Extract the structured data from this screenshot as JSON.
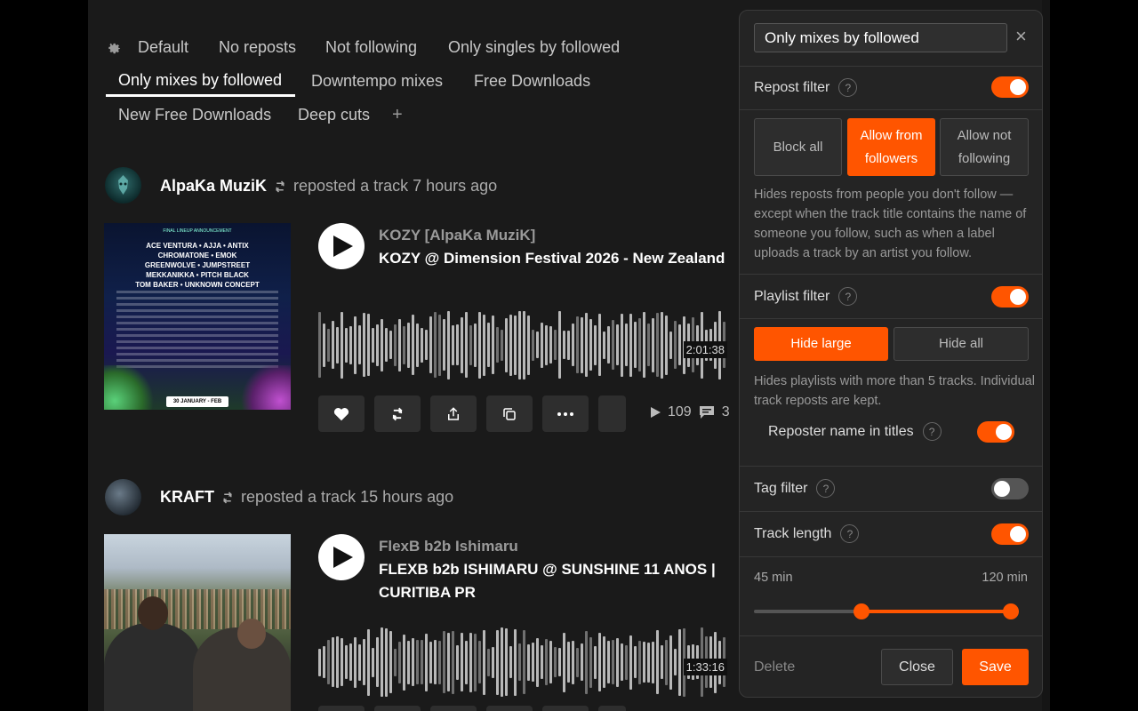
{
  "tabs": {
    "row1": [
      "Default",
      "No reposts",
      "Not following",
      "Only singles by followed"
    ],
    "row2": [
      "Only mixes by followed",
      "Downtempo mixes",
      "Free Downloads"
    ],
    "row3": [
      "New Free Downloads",
      "Deep cuts"
    ],
    "active": "Only mixes by followed",
    "add": "+"
  },
  "feed": [
    {
      "reposter": "AlpaKa MuziK",
      "action": "reposted a track 7 hours ago",
      "artist": "KOZY [AlpaKa MuziK]",
      "title": "KOZY @ Dimension Festival 2026 - New Zealand",
      "duration": "2:01:38",
      "plays": "109",
      "comments": "3",
      "poster": {
        "header": "FINAL LINEUP ANNOUNCEMENT",
        "lines": [
          "ACE VENTURA • AJJA • ANTIX",
          "CHROMATONE • EMOK",
          "GREENWOLVE • JUMPSTREET",
          "MEKKANIKKA • PITCH BLACK",
          "TOM BAKER • UNKNOWN CONCEPT"
        ],
        "date": "30 JANUARY - FEB"
      }
    },
    {
      "reposter": "KRAFT",
      "action": "reposted a track 15 hours ago",
      "artist": "FlexB b2b Ishimaru",
      "title": "FLEXB b2b ISHIMARU @ SUNSHINE 11 ANOS | CURITIBA PR",
      "duration": "1:33:16"
    }
  ],
  "panel": {
    "name": "Only mixes by followed",
    "close": "×",
    "repost_filter": {
      "label": "Repost filter",
      "help": "?",
      "enabled": true,
      "options": [
        "Block all",
        "Allow from followers",
        "Allow not following"
      ],
      "selected": 1,
      "description": "Hides reposts from people you don't follow — except when the track title contains the name of someone you follow, such as when a label uploads a track by an artist you follow."
    },
    "playlist_filter": {
      "label": "Playlist filter",
      "help": "?",
      "enabled": true,
      "options": [
        "Hide large",
        "Hide all"
      ],
      "selected": 0,
      "description": "Hides playlists with more than 5 tracks. Individual track reposts are kept."
    },
    "reposter_name": {
      "label": "Reposter name in titles",
      "help": "?",
      "enabled": true
    },
    "tag_filter": {
      "label": "Tag filter",
      "help": "?",
      "enabled": false
    },
    "track_length": {
      "label": "Track length",
      "help": "?",
      "enabled": true,
      "min_label": "45 min",
      "max_label": "120 min",
      "range_low": 0.4,
      "range_high": 1.0
    },
    "footer": {
      "delete": "Delete",
      "close": "Close",
      "save": "Save"
    }
  },
  "colors": {
    "accent": "#ff5500",
    "background": "#1a1a1a",
    "panel": "#242424"
  }
}
